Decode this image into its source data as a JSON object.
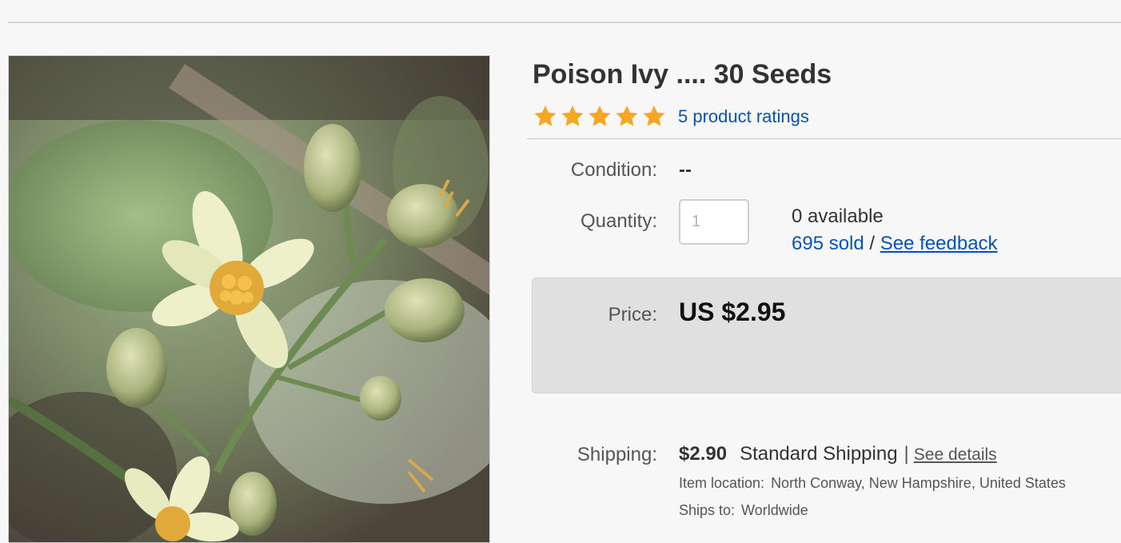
{
  "listing": {
    "title": "Poison Ivy .... 30 Seeds",
    "rating": {
      "stars": 5,
      "max_stars": 5,
      "ratings_text": "5 product ratings"
    },
    "condition": {
      "label": "Condition:",
      "value": "--"
    },
    "quantity": {
      "label": "Quantity:",
      "placeholder": "1",
      "available_text": "0 available",
      "sold_text": "695 sold",
      "separator": "/",
      "feedback_link": "See feedback"
    },
    "price": {
      "label": "Price:",
      "value": "US $2.95"
    },
    "shipping": {
      "label": "Shipping:",
      "cost": "$2.90",
      "method": "Standard Shipping",
      "separator": "|",
      "details_link": "See details",
      "location_label": "Item location:",
      "location_value": "North Conway, New Hampshire, United States",
      "ships_to_label": "Ships to:",
      "ships_to_value": "Worldwide"
    }
  },
  "colors": {
    "link": "#0654ba",
    "star": "#f5a623",
    "price_box": "#e0e0e0"
  },
  "icons": {
    "rating_star": "star-icon",
    "product_photo": "poison-ivy-flower-photo"
  }
}
